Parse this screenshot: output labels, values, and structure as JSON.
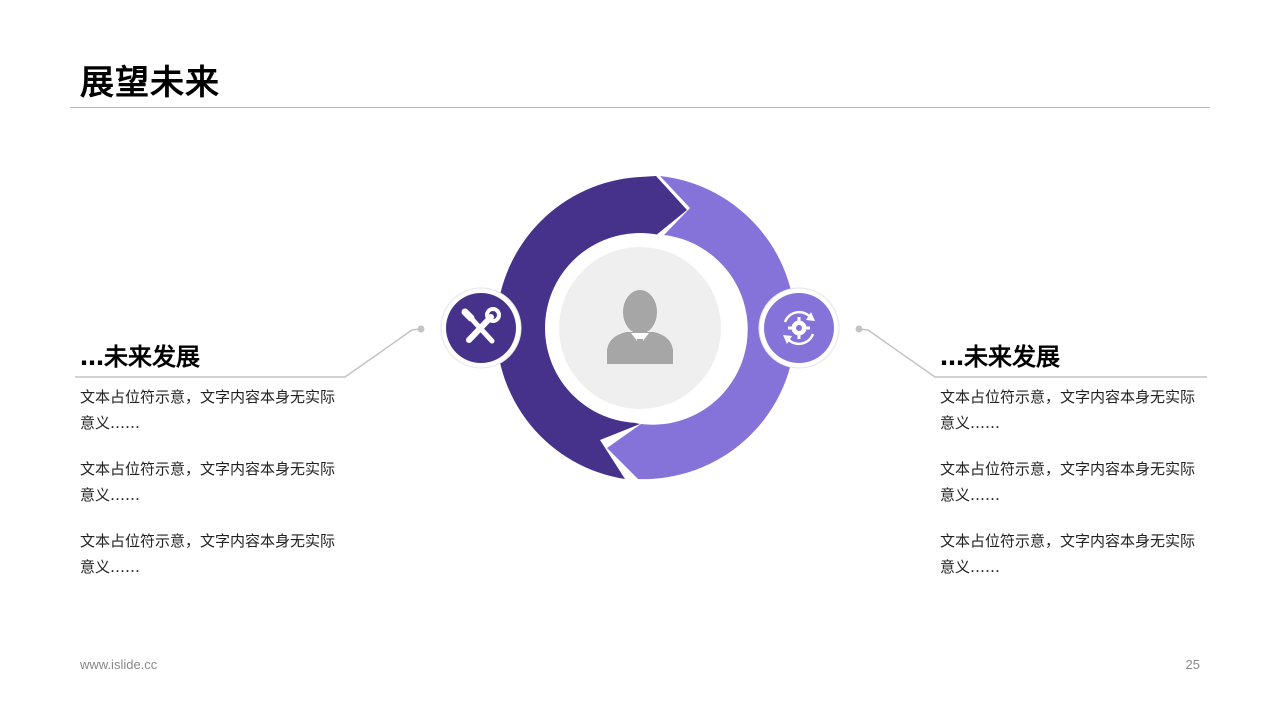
{
  "slide": {
    "title": "展望未来",
    "footer_url": "www.islide.cc",
    "page_number": "25"
  },
  "colors": {
    "dark_purple": "#46328A",
    "light_purple": "#8673D9",
    "center_gray": "#EFEFEF",
    "person_gray": "#A6A6A6"
  },
  "icons": {
    "center": "person-icon",
    "left": "tools-icon",
    "right": "gear-refresh-icon"
  },
  "left_panel": {
    "heading": "…未来发展",
    "items": [
      "文本占位符示意，文字内容本身无实际意义……",
      "文本占位符示意，文字内容本身无实际意义……",
      "文本占位符示意，文字内容本身无实际意义……"
    ]
  },
  "right_panel": {
    "heading": "…未来发展",
    "items": [
      "文本占位符示意，文字内容本身无实际意义……",
      "文本占位符示意，文字内容本身无实际意义……",
      "文本占位符示意，文字内容本身无实际意义……"
    ]
  }
}
